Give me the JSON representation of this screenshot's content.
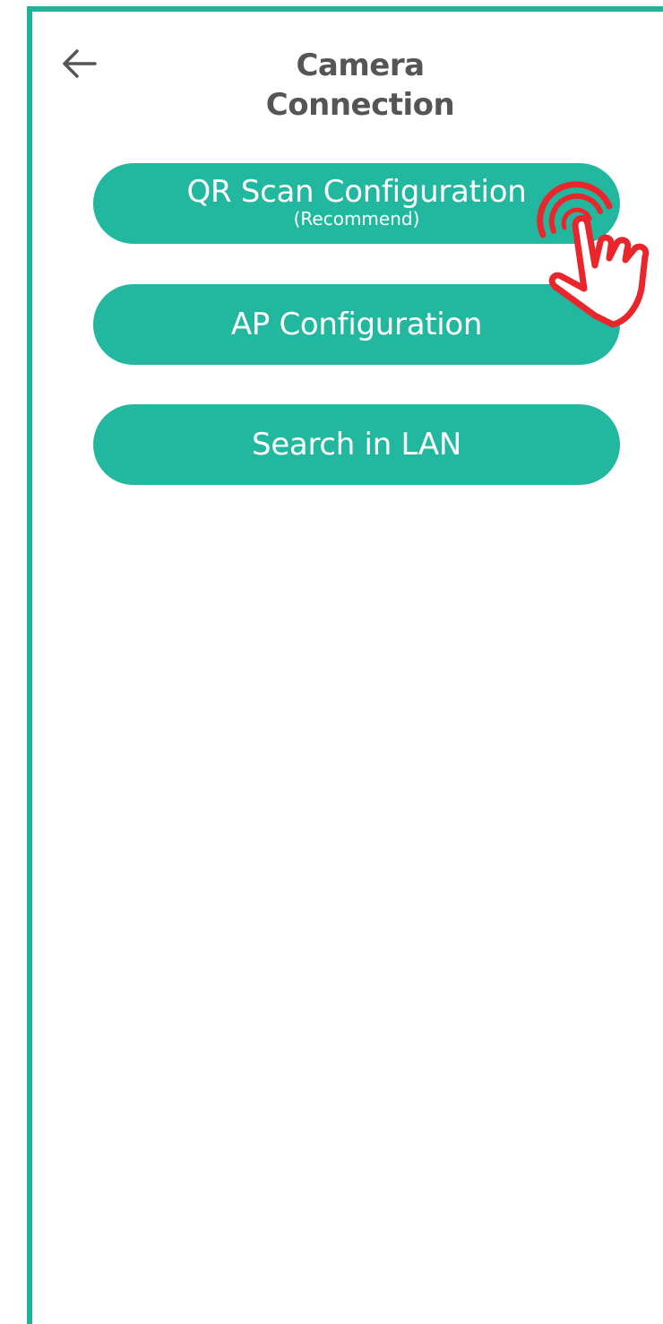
{
  "header": {
    "title": "Camera Connection",
    "back_icon": "arrow-left-icon"
  },
  "buttons": [
    {
      "label": "QR Scan Configuration",
      "sublabel": "(Recommend)"
    },
    {
      "label": "AP Configuration"
    },
    {
      "label": "Search in LAN"
    }
  ],
  "overlay": {
    "icon": "tap-hand-icon",
    "color": "#e8262b"
  },
  "colors": {
    "accent": "#22b8a0",
    "frame": "#1fb39b",
    "title_text": "#555555"
  }
}
